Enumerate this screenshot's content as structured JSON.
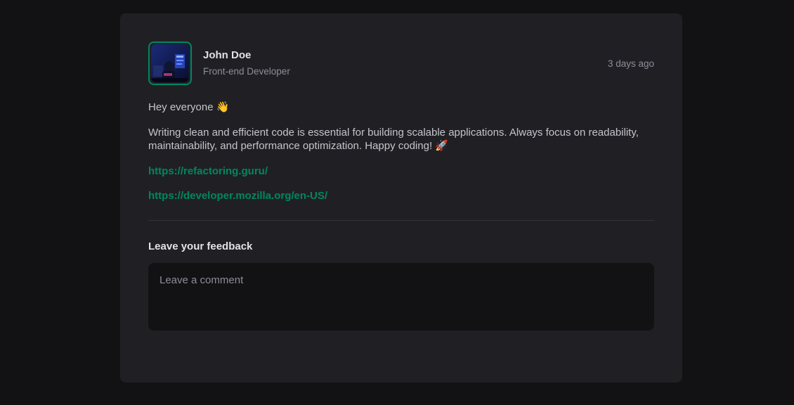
{
  "post": {
    "author": {
      "name": "John Doe",
      "role": "Front-end Developer",
      "avatar_icon": "developer-avatar-image"
    },
    "time": "3 days ago",
    "content": {
      "greeting": "Hey everyone 👋",
      "body": "Writing clean and efficient code is essential for building scalable applications. Always focus on readability, maintainability, and performance optimization. Happy coding! 🚀",
      "links": [
        "https://refactoring.guru/",
        "https://developer.mozilla.org/en-US/"
      ]
    }
  },
  "feedback": {
    "title": "Leave your feedback",
    "placeholder": "Leave a comment",
    "value": ""
  },
  "colors": {
    "accent": "#00875f",
    "background": "#121214",
    "card": "#202024"
  }
}
